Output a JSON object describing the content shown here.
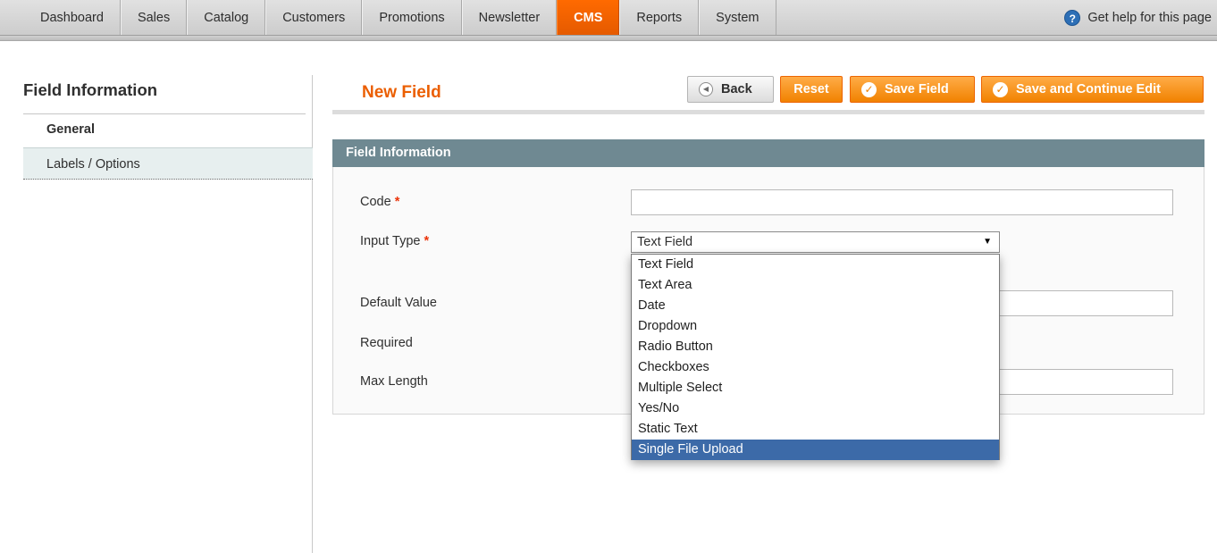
{
  "nav": {
    "items": [
      {
        "label": "Dashboard",
        "active": false
      },
      {
        "label": "Sales",
        "active": false
      },
      {
        "label": "Catalog",
        "active": false
      },
      {
        "label": "Customers",
        "active": false
      },
      {
        "label": "Promotions",
        "active": false
      },
      {
        "label": "Newsletter",
        "active": false
      },
      {
        "label": "CMS",
        "active": true
      },
      {
        "label": "Reports",
        "active": false
      },
      {
        "label": "System",
        "active": false
      }
    ],
    "help_icon": "question-circle-icon",
    "help_label": "Get help for this page"
  },
  "sidebar": {
    "title": "Field Information",
    "tabs": [
      {
        "label": "General",
        "active": true
      },
      {
        "label": "Labels / Options",
        "active": false
      }
    ]
  },
  "header": {
    "title": "New Field",
    "buttons": {
      "back": "Back",
      "reset": "Reset",
      "save": "Save Field",
      "save_continue": "Save and Continue Edit"
    }
  },
  "fieldset": {
    "title": "Field Information",
    "required_marker": "*",
    "fields": {
      "code": {
        "label": "Code",
        "required": true,
        "value": ""
      },
      "input_type": {
        "label": "Input Type",
        "required": true,
        "value": "Text Field"
      },
      "default_value": {
        "label": "Default Value",
        "required": false,
        "value": ""
      },
      "required": {
        "label": "Required",
        "required": false
      },
      "max_length": {
        "label": "Max Length",
        "required": false,
        "value": ""
      }
    }
  },
  "dropdown": {
    "options": [
      "Text Field",
      "Text Area",
      "Date",
      "Dropdown",
      "Radio Button",
      "Checkboxes",
      "Multiple Select",
      "Yes/No",
      "Static Text",
      "Single File Upload"
    ],
    "highlighted": "Single File Upload"
  },
  "colors": {
    "accent": "#eb5e00",
    "nav_active": "#ff6a00",
    "fieldset_header": "#6f8992",
    "option_highlight": "#3c6aa8"
  }
}
